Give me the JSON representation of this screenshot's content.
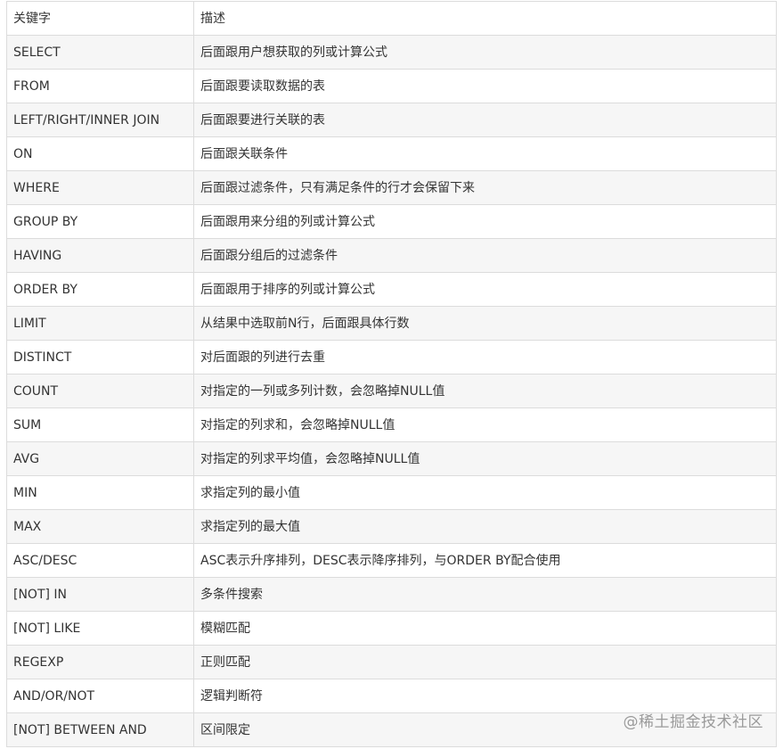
{
  "table": {
    "header": [
      "关键字",
      "描述"
    ],
    "rows": [
      [
        "SELECT",
        "后面跟用户想获取的列或计算公式"
      ],
      [
        "FROM",
        "后面跟要读取数据的表"
      ],
      [
        "LEFT/RIGHT/INNER JOIN",
        "后面跟要进行关联的表"
      ],
      [
        "ON",
        "后面跟关联条件"
      ],
      [
        "WHERE",
        "后面跟过滤条件，只有满足条件的行才会保留下来"
      ],
      [
        "GROUP BY",
        "后面跟用来分组的列或计算公式"
      ],
      [
        "HAVING",
        "后面跟分组后的过滤条件"
      ],
      [
        "ORDER BY",
        "后面跟用于排序的列或计算公式"
      ],
      [
        "LIMIT",
        "从结果中选取前N行，后面跟具体行数"
      ],
      [
        "DISTINCT",
        "对后面跟的列进行去重"
      ],
      [
        "COUNT",
        "对指定的一列或多列计数，会忽略掉NULL值"
      ],
      [
        "SUM",
        "对指定的列求和，会忽略掉NULL值"
      ],
      [
        "AVG",
        "对指定的列求平均值，会忽略掉NULL值"
      ],
      [
        "MIN",
        "求指定列的最小值"
      ],
      [
        "MAX",
        "求指定列的最大值"
      ],
      [
        "ASC/DESC",
        "ASC表示升序排列，DESC表示降序排列，与ORDER BY配合使用"
      ],
      [
        "[NOT] IN",
        "多条件搜索"
      ],
      [
        "[NOT] LIKE",
        "模糊匹配"
      ],
      [
        "REGEXP",
        "正则匹配"
      ],
      [
        "AND/OR/NOT",
        "逻辑判断符"
      ],
      [
        "[NOT] BETWEEN AND",
        "区间限定"
      ]
    ]
  },
  "watermark": "@稀土掘金技术社区",
  "colors": {
    "stripe": "#f6f6f6",
    "border": "#dcdcdc",
    "text": "#333333"
  }
}
